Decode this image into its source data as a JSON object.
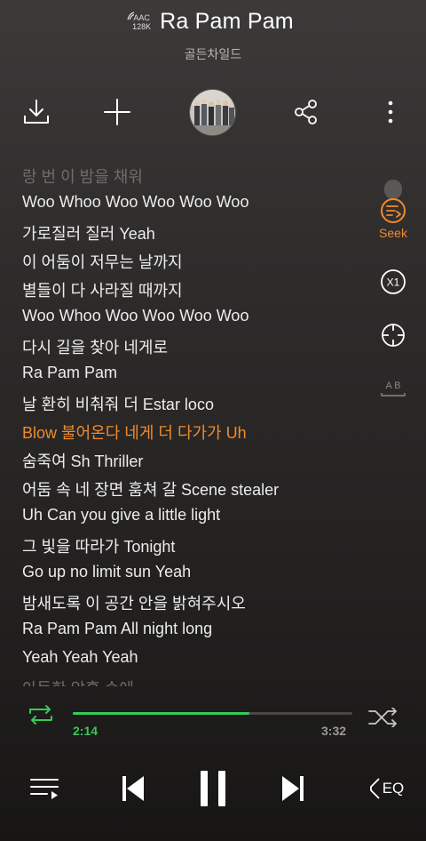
{
  "header": {
    "codec_top": "AAC",
    "codec_bottom": "128K",
    "title": "Ra Pam Pam",
    "artist": "골든차일드"
  },
  "toolbar": {
    "download_icon": "download-icon",
    "add_icon": "plus-icon",
    "share_icon": "share-icon",
    "more_icon": "more-vertical-icon"
  },
  "lyrics": [
    "랑 번 이 밤을 채워",
    "Woo Whoo Woo Woo Woo Woo",
    "가로질러 질러 Yeah",
    "이 어둠이 저무는 날까지",
    "별들이 다 사라질 때까지",
    "Woo Whoo Woo Woo Woo Woo",
    "다시 길을 찾아 네게로",
    "Ra Pam Pam",
    "날 환히 비춰줘 더 Estar loco",
    "Blow 불어온다 네게 더 다가가 Uh",
    "숨죽여 Sh Thriller",
    "어둠 속 네 장면 훔쳐 갈 Scene stealer",
    "Uh Can you give a little light",
    "그 빛을 따라가 Tonight",
    "Go up no limit sun Yeah",
    "밤새도록 이 공간 안을 밝혀주시오",
    "Ra Pam Pam All night long",
    "Yeah Yeah Yeah",
    "아득한 암흑 속에"
  ],
  "active_lyric_index": 9,
  "side": {
    "seek_label": "Seek",
    "speed_label": "X1",
    "ab_label": "A B"
  },
  "player": {
    "current_time": "2:14",
    "total_time": "3:32",
    "progress": 0.632,
    "eq_label": "EQ"
  },
  "colors": {
    "accent_orange": "#f08a2c",
    "progress_green": "#37c956"
  }
}
